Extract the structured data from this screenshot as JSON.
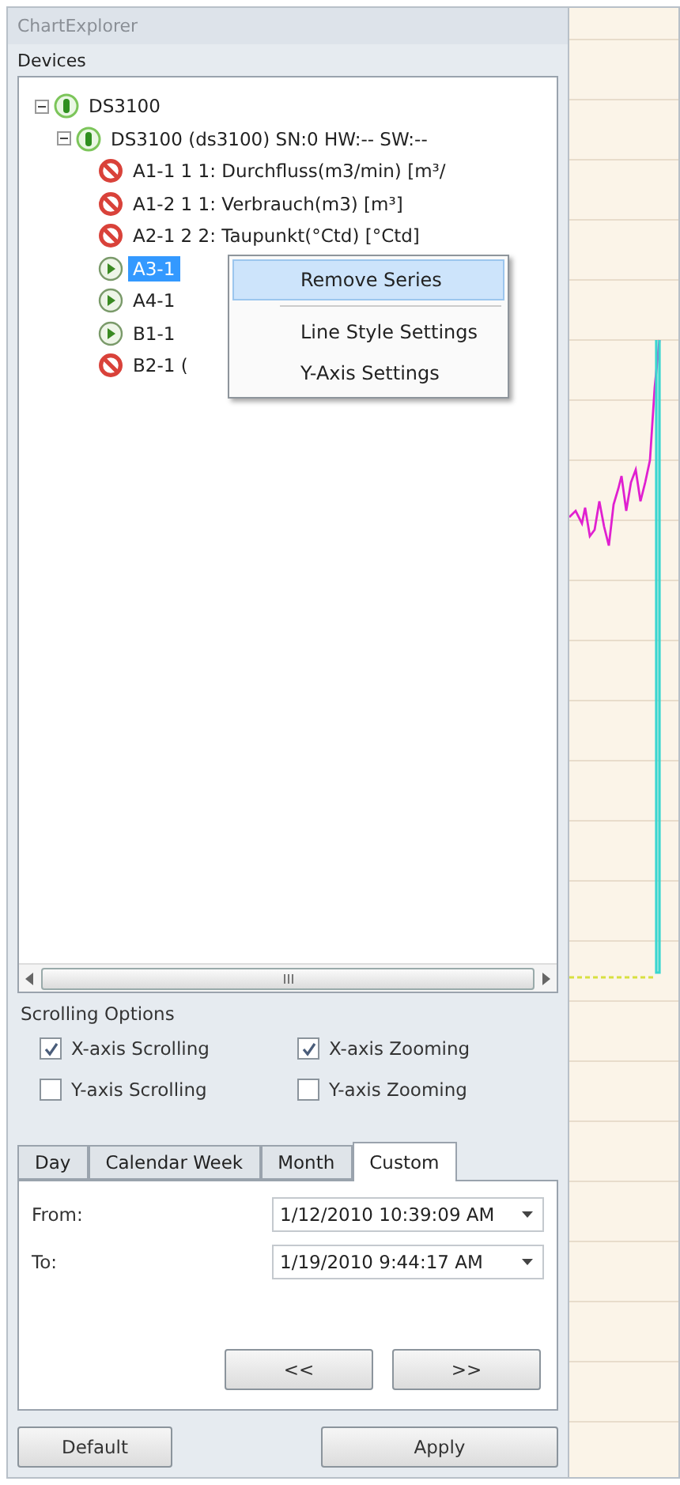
{
  "panel": {
    "title": "ChartExplorer",
    "devices_header": "Devices"
  },
  "tree": [
    {
      "label": "DS3100",
      "kind": "device",
      "expanded": true,
      "selected": false,
      "children": [
        {
          "label": "DS3100 (ds3100)  SN:0  HW:--  SW:--",
          "kind": "device",
          "expanded": true,
          "selected": false,
          "children": [
            {
              "label": "A1-1 1 1: Durchfluss(m3/min) [m³/",
              "kind": "inactive",
              "selected": false
            },
            {
              "label": "A1-2 1 1: Verbrauch(m3) [m³]",
              "kind": "inactive",
              "selected": false
            },
            {
              "label": "A2-1 2 2: Taupunkt(°Ctd) [°Ctd]",
              "kind": "inactive",
              "selected": false
            },
            {
              "label": "A3-1",
              "kind": "active",
              "selected": true
            },
            {
              "label": "A4-1",
              "kind": "active",
              "selected": false
            },
            {
              "label": "B1-1",
              "kind": "active",
              "selected": false
            },
            {
              "label": "B2-1 (",
              "kind": "inactive",
              "selected": false
            }
          ]
        }
      ]
    }
  ],
  "context_menu": [
    {
      "label": "Remove Series",
      "kind": "item",
      "selected": true
    },
    {
      "kind": "separator"
    },
    {
      "label": "Line Style Settings",
      "kind": "item",
      "selected": false
    },
    {
      "label": "Y-Axis Settings",
      "kind": "item",
      "selected": false
    }
  ],
  "scrolling_options": {
    "title": "Scrolling Options",
    "options": [
      {
        "label": "X-axis Scrolling",
        "checked": true
      },
      {
        "label": "X-axis Zooming",
        "checked": true
      },
      {
        "label": "Y-axis Scrolling",
        "checked": false
      },
      {
        "label": "Y-axis Zooming",
        "checked": false
      }
    ]
  },
  "tabs": [
    {
      "label": "Day",
      "selected": false
    },
    {
      "label": "Calendar Week",
      "selected": false
    },
    {
      "label": "Month",
      "selected": false
    },
    {
      "label": "Custom",
      "selected": true
    }
  ],
  "range": [
    {
      "label": "From:",
      "value": "1/12/2010 10:39:09 AM"
    },
    {
      "label": "To:",
      "value": "1/19/2010 9:44:17 AM"
    }
  ],
  "nav_buttons": [
    "<<",
    ">>"
  ],
  "buttons": [
    "Default",
    "Apply"
  ]
}
